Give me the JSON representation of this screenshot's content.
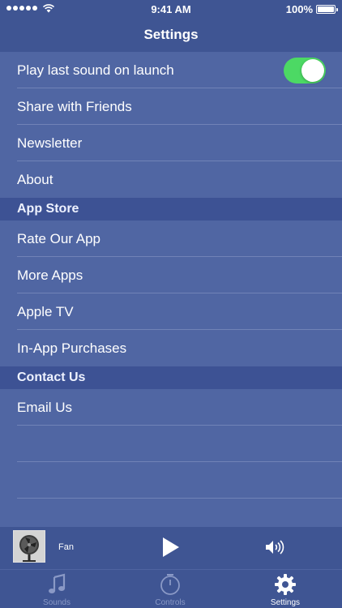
{
  "status_bar": {
    "time": "9:41 AM",
    "battery": "100%",
    "battery_level": 1.0
  },
  "nav": {
    "title": "Settings"
  },
  "settings": {
    "rows_general": [
      {
        "label": "Play last sound on launch",
        "toggle": true,
        "toggle_on": true
      },
      {
        "label": "Share with Friends"
      },
      {
        "label": "Newsletter"
      },
      {
        "label": "About"
      }
    ],
    "section_app_store": "App Store",
    "rows_app_store": [
      {
        "label": "Rate Our App"
      },
      {
        "label": "More Apps"
      },
      {
        "label": "Apple TV"
      },
      {
        "label": "In-App Purchases"
      }
    ],
    "section_contact": "Contact Us",
    "rows_contact": [
      {
        "label": "Email Us"
      }
    ]
  },
  "player": {
    "track_name": "Fan",
    "play_icon": "play-icon",
    "volume_icon": "speaker-volume-icon"
  },
  "tabs": [
    {
      "label": "Sounds",
      "icon": "music-note-icon",
      "active": false
    },
    {
      "label": "Controls",
      "icon": "timer-icon",
      "active": false
    },
    {
      "label": "Settings",
      "icon": "gear-icon",
      "active": true
    }
  ],
  "colors": {
    "background": "#5066a3",
    "bars": "#3f5593",
    "toggle_on": "#4cd964"
  }
}
